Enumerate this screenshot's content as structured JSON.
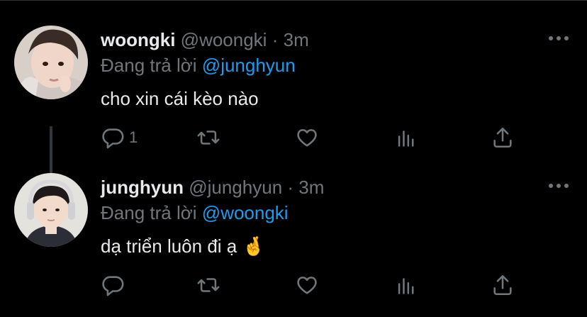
{
  "tweets": [
    {
      "name": "woongki",
      "handle": "@woongki",
      "separator": "·",
      "time": "3m",
      "reply_prefix": "Đang trả lời",
      "reply_to": "@junghyun",
      "text": "cho xin cái kèo nào",
      "reply_count": "1"
    },
    {
      "name": "junghyun",
      "handle": "@junghyun",
      "separator": "·",
      "time": "3m",
      "reply_prefix": "Đang trả lời",
      "reply_to": "@woongki",
      "text": "dạ triển luôn đi ạ 🤞",
      "reply_count": ""
    }
  ],
  "colors": {
    "background": "#000000",
    "text": "#e7e9ea",
    "muted": "#71767b",
    "accent": "#1d9bf0",
    "thread_line": "#333639"
  },
  "icons": [
    "more-icon",
    "reply-icon",
    "retweet-icon",
    "like-icon",
    "views-icon",
    "share-icon"
  ]
}
